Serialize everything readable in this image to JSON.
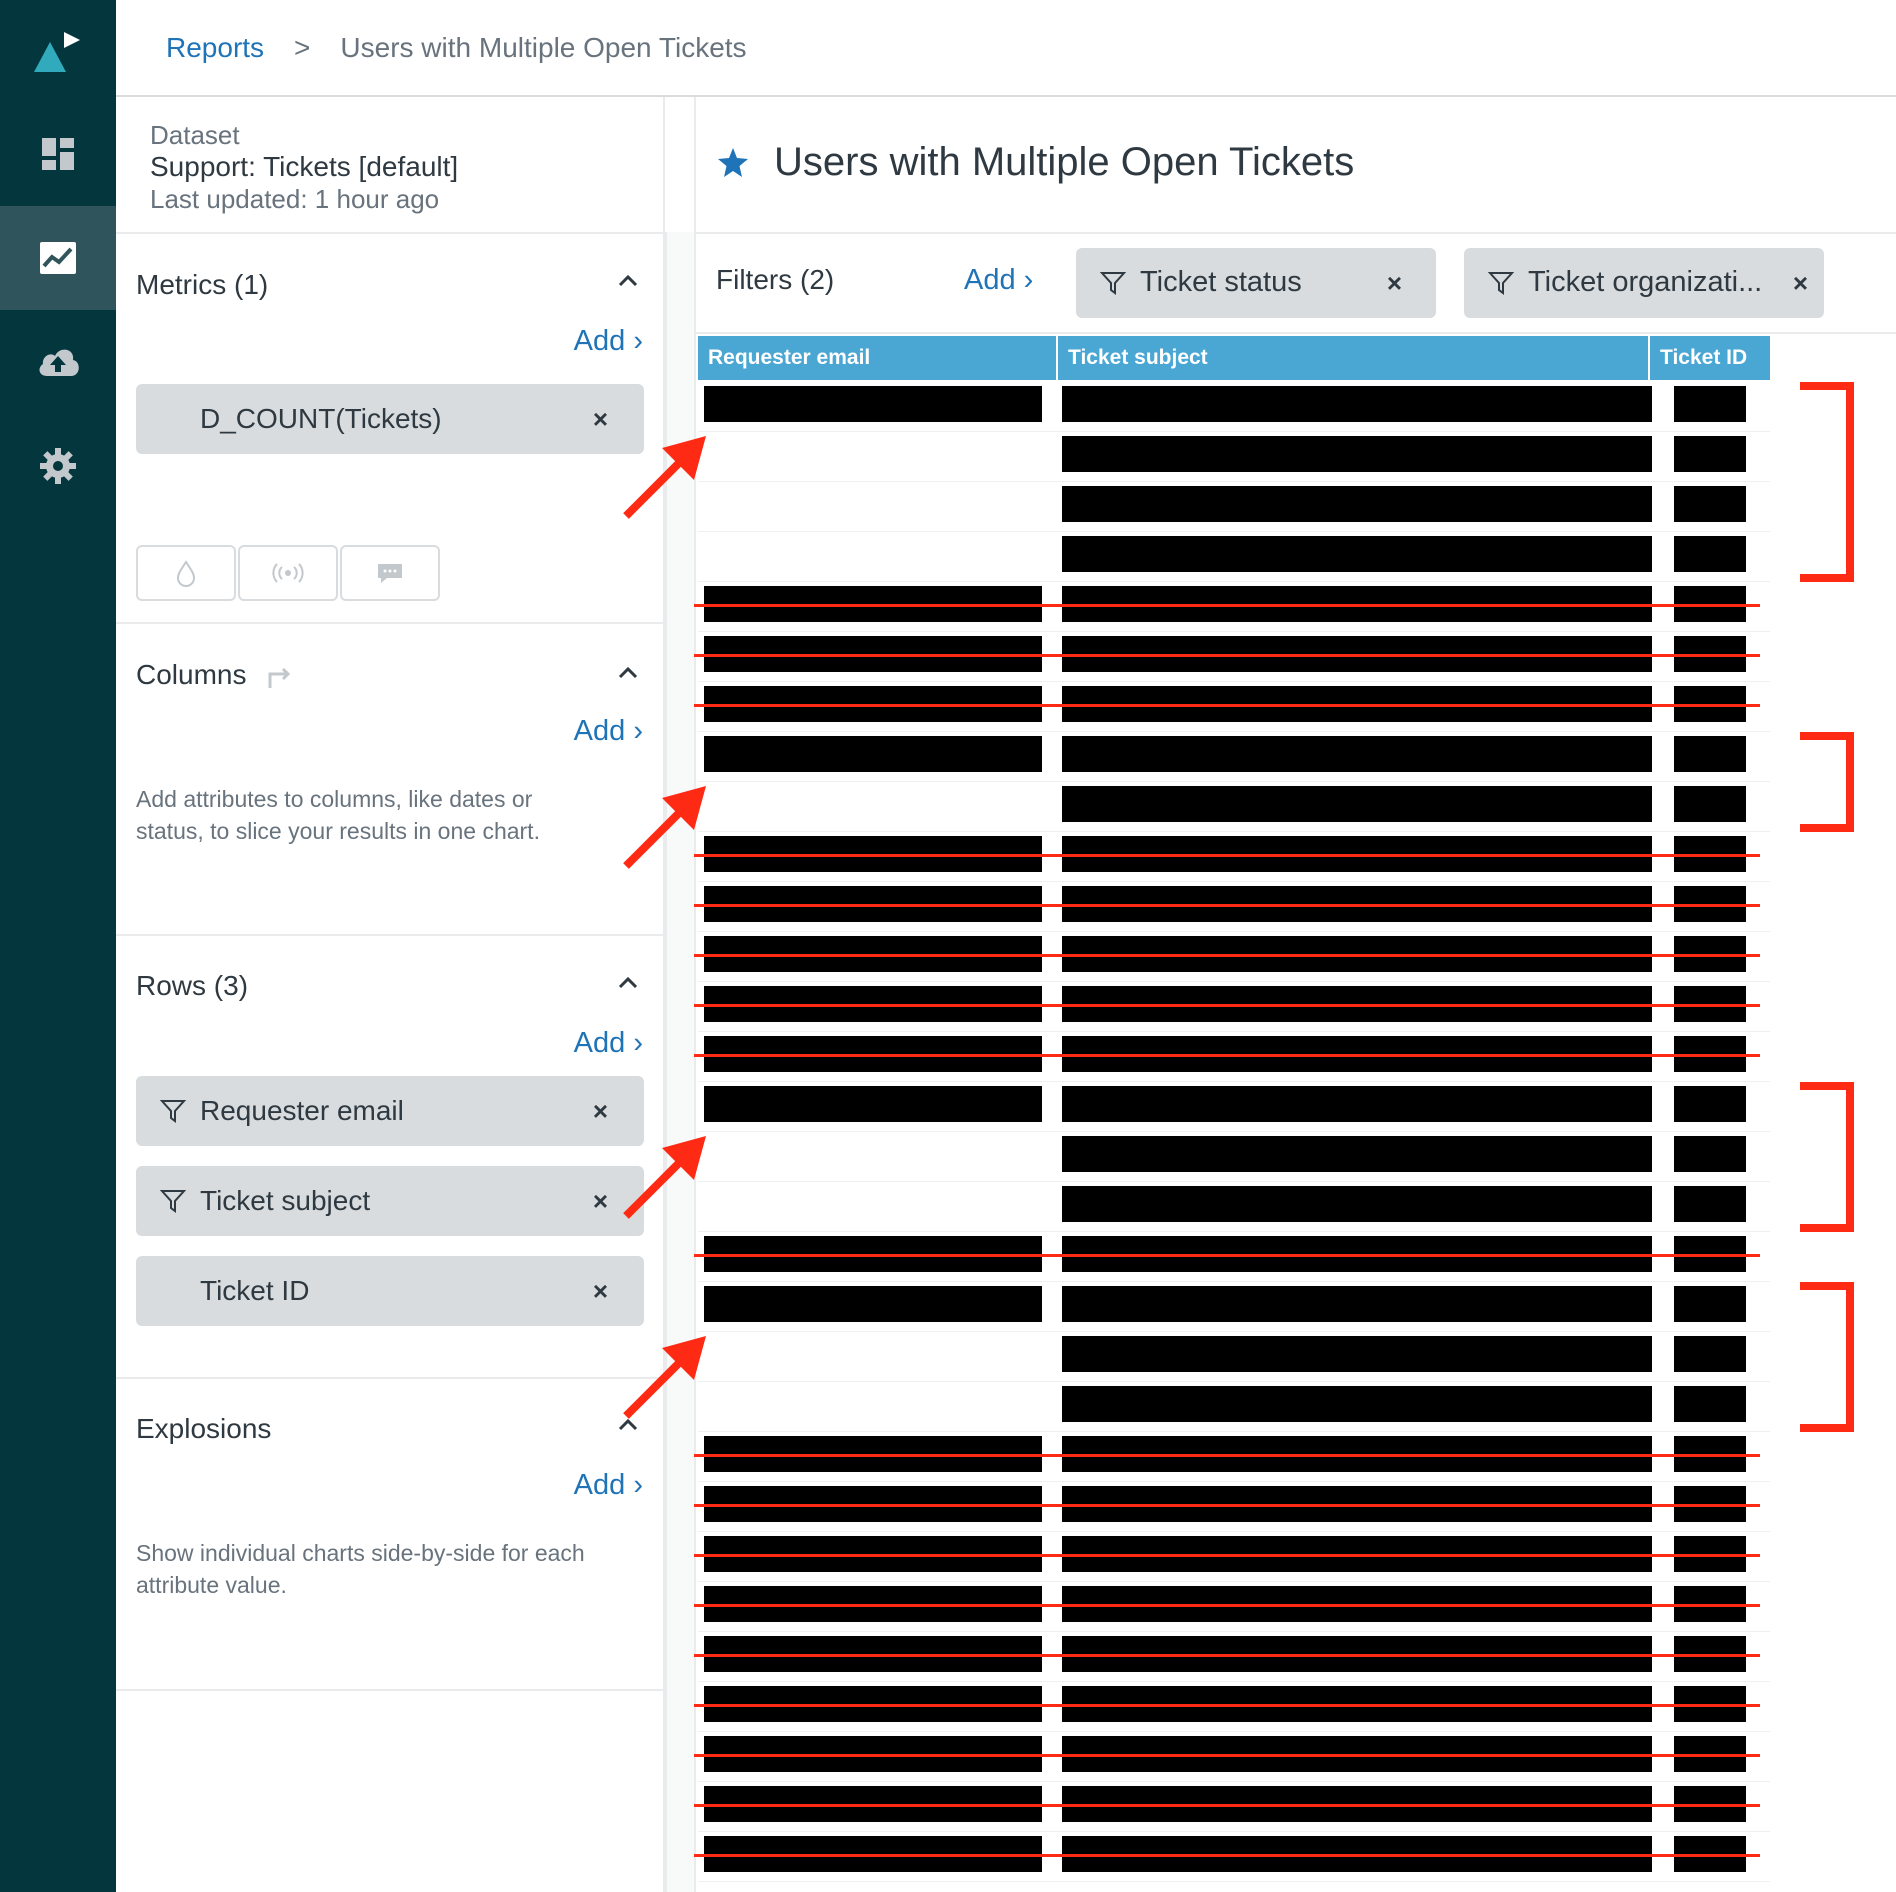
{
  "breadcrumb": {
    "link": "Reports",
    "separator": ">",
    "current": "Users with Multiple Open Tickets"
  },
  "nav": {
    "icons": [
      "logo-icon",
      "dashboard-icon",
      "reports-icon",
      "cloud-upload-icon",
      "gear-icon"
    ],
    "active": "reports-icon"
  },
  "dataset": {
    "label": "Dataset",
    "name": "Support: Tickets [default]",
    "updated": "Last updated: 1 hour ago"
  },
  "metrics": {
    "title": "Metrics (1)",
    "add": "Add ›",
    "items": [
      "D_COUNT(Tickets)"
    ],
    "remove": "×"
  },
  "columns": {
    "title": "Columns",
    "add": "Add ›",
    "hint": "Add attributes to columns, like dates or status, to slice your results in one chart."
  },
  "rows": {
    "title": "Rows (3)",
    "add": "Add ›",
    "items": [
      "Requester email",
      "Ticket subject",
      "Ticket ID"
    ],
    "remove": "×"
  },
  "explosions": {
    "title": "Explosions",
    "add": "Add ›",
    "hint": "Show individual charts side-by-side for each attribute value."
  },
  "report": {
    "title": "Users with Multiple Open Tickets"
  },
  "filters": {
    "label": "Filters (2)",
    "add": "Add ›",
    "chips": [
      "Ticket status",
      "Ticket organizati..."
    ],
    "remove": "×"
  },
  "table": {
    "headers": [
      "Requester email",
      "Ticket subject",
      "Ticket ID"
    ],
    "rows": [
      {
        "email": true,
        "struck": false
      },
      {
        "email": false,
        "struck": false
      },
      {
        "email": false,
        "struck": false
      },
      {
        "email": false,
        "struck": false
      },
      {
        "email": true,
        "struck": true
      },
      {
        "email": true,
        "struck": true
      },
      {
        "email": true,
        "struck": true
      },
      {
        "email": true,
        "struck": false
      },
      {
        "email": false,
        "struck": false
      },
      {
        "email": true,
        "struck": true
      },
      {
        "email": true,
        "struck": true
      },
      {
        "email": true,
        "struck": true
      },
      {
        "email": true,
        "struck": true
      },
      {
        "email": true,
        "struck": true
      },
      {
        "email": true,
        "struck": false
      },
      {
        "email": false,
        "struck": false
      },
      {
        "email": false,
        "struck": false
      },
      {
        "email": true,
        "struck": true
      },
      {
        "email": true,
        "struck": false
      },
      {
        "email": false,
        "struck": false
      },
      {
        "email": false,
        "struck": false
      },
      {
        "email": true,
        "struck": true
      },
      {
        "email": true,
        "struck": true
      },
      {
        "email": true,
        "struck": true
      },
      {
        "email": true,
        "struck": true
      },
      {
        "email": true,
        "struck": true
      },
      {
        "email": true,
        "struck": true
      },
      {
        "email": true,
        "struck": true
      },
      {
        "email": true,
        "struck": true
      },
      {
        "email": true,
        "struck": true
      }
    ]
  },
  "colors": {
    "rail": "#03363d",
    "link": "#1f73b7",
    "header": "#4aa7d4",
    "annotation": "#ff2a14"
  }
}
